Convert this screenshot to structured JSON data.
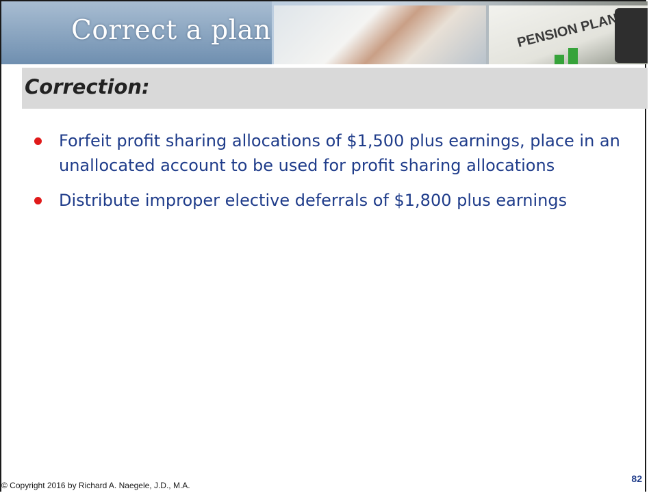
{
  "banner": {
    "title": "Correct a plan",
    "image_caption": "PENSION PLAN"
  },
  "section": {
    "title": "Correction:"
  },
  "bullets": [
    "Forfeit profit sharing allocations of $1,500 plus earnings, place in an unallocated account to be used for profit sharing allocations",
    "Distribute improper elective deferrals of $1,800 plus earnings"
  ],
  "footer": {
    "copyright": "© Copyright 2016 by Richard A. Naegele, J.D., M.A.",
    "page_number": "82"
  },
  "colors": {
    "bullet_text": "#1f3c8a",
    "bullet_dot": "#e01a1a",
    "section_bar": "#d9d9d9"
  }
}
